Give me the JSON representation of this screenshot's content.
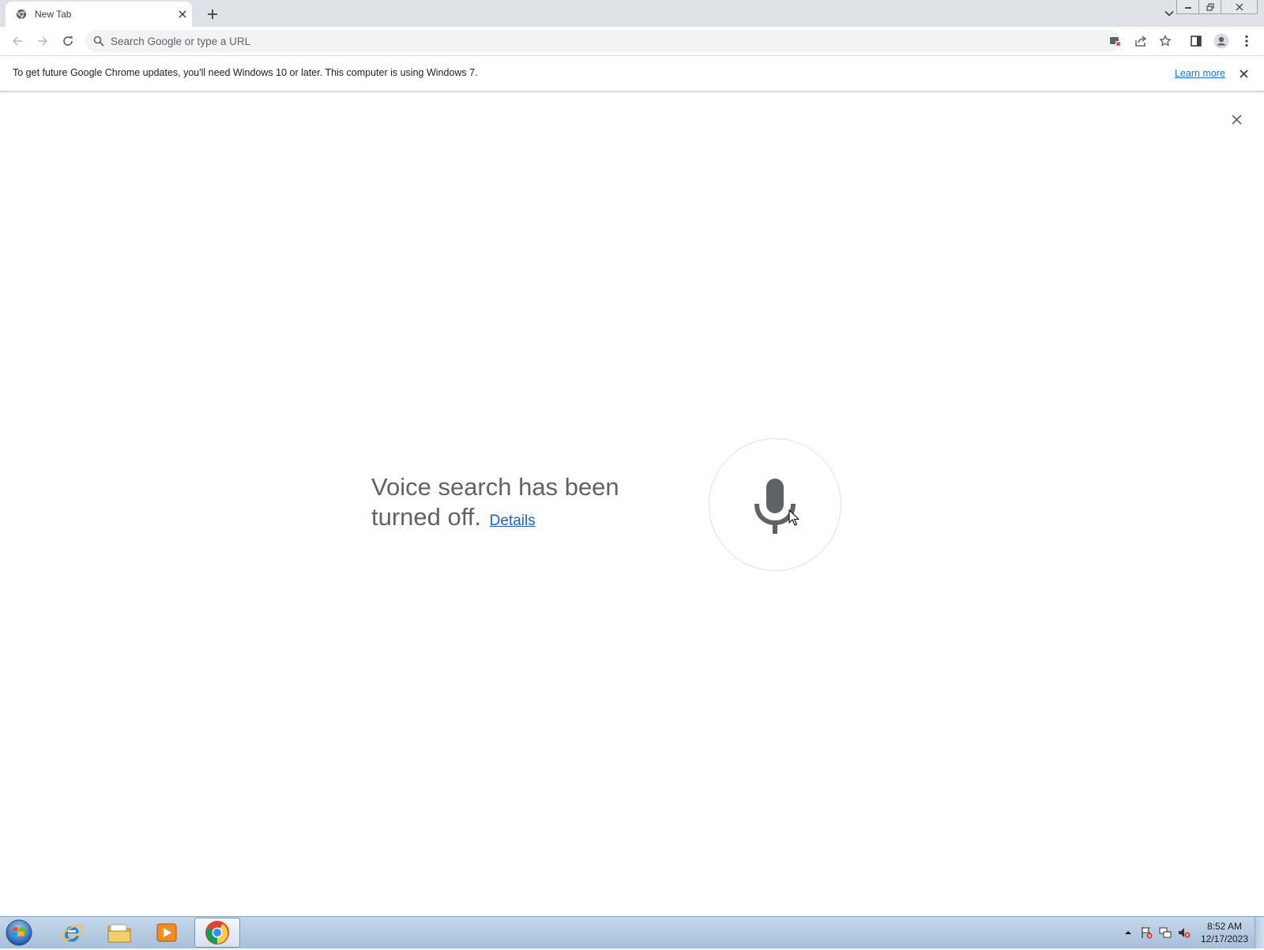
{
  "tab": {
    "title": "New Tab",
    "favicon": "chrome-icon"
  },
  "omnibox": {
    "placeholder": "Search Google or type a URL",
    "value": ""
  },
  "infobar": {
    "message": "To get future Google Chrome updates, you'll need Windows 10 or later. This computer is using Windows 7.",
    "link": "Learn more"
  },
  "voice_search": {
    "message": "Voice search has been turned off.",
    "message_line1": "Voice search has been",
    "message_line2": "turned off.",
    "details_link": "Details"
  },
  "taskbar": {
    "apps": [
      "internet-explorer-icon",
      "file-explorer-icon",
      "media-player-icon",
      "chrome-icon"
    ],
    "active_app": "chrome-icon",
    "clock_time": "8:52 AM",
    "clock_date": "12/17/2023"
  },
  "colors": {
    "link_blue": "#1a73e8",
    "tabstrip_bg": "#dee1e6",
    "mic_gray": "#5f6368",
    "taskbar_bg": "#b6cbe1"
  }
}
